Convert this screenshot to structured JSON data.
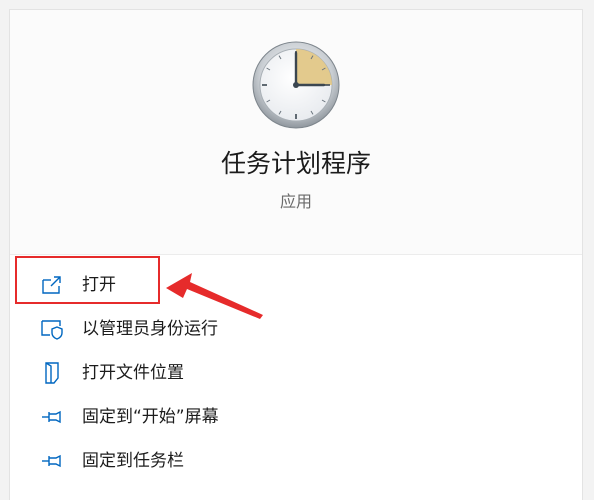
{
  "app": {
    "title": "任务计划程序",
    "type_label": "应用",
    "icon": "clock-icon"
  },
  "menu": {
    "items": [
      {
        "label": "打开",
        "icon": "open-external-icon"
      },
      {
        "label": "以管理员身份运行",
        "icon": "admin-shield-icon"
      },
      {
        "label": "打开文件位置",
        "icon": "file-location-icon"
      },
      {
        "label": "固定到“开始”屏幕",
        "icon": "pin-icon"
      },
      {
        "label": "固定到任务栏",
        "icon": "pin-icon"
      }
    ]
  },
  "colors": {
    "accent": "#0067c0",
    "annotation": "#e62b2b"
  }
}
